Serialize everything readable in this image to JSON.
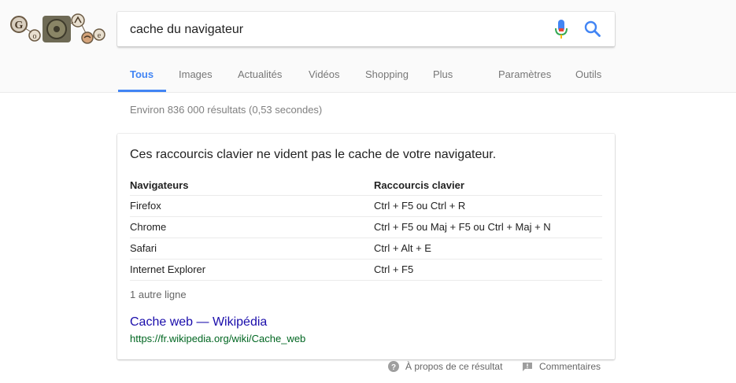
{
  "search": {
    "query": "cache du navigateur"
  },
  "icons": {
    "logo": "google-doodle-logo",
    "mic": "microphone-icon",
    "search": "search-icon",
    "help": "help-circle-icon",
    "feedback": "feedback-icon"
  },
  "colors": {
    "accent": "#4285f4",
    "link": "#1a0dab",
    "url": "#006621"
  },
  "tabs": [
    {
      "label": "Tous",
      "active": true
    },
    {
      "label": "Images"
    },
    {
      "label": "Actualités"
    },
    {
      "label": "Vidéos"
    },
    {
      "label": "Shopping"
    },
    {
      "label": "Plus"
    },
    {
      "label": "Paramètres"
    },
    {
      "label": "Outils"
    }
  ],
  "stats": "Environ 836 000 résultats (0,53 secondes)",
  "snippet": {
    "headline": "Ces raccourcis clavier ne vident pas le cache de votre navigateur.",
    "columns": [
      "Navigateurs",
      "Raccourcis clavier"
    ],
    "rows": [
      [
        "Firefox",
        "Ctrl + F5 ou Ctrl + R"
      ],
      [
        "Chrome",
        "Ctrl + F5 ou Maj + F5 ou Ctrl + Maj + N"
      ],
      [
        "Safari",
        "Ctrl + Alt + E"
      ],
      [
        "Internet Explorer",
        "Ctrl + F5"
      ]
    ],
    "more": "1 autre ligne",
    "source_title": "Cache web — Wikipédia",
    "source_url": "https://fr.wikipedia.org/wiki/Cache_web"
  },
  "footer": {
    "about": "À propos de ce résultat",
    "feedback": "Commentaires"
  }
}
